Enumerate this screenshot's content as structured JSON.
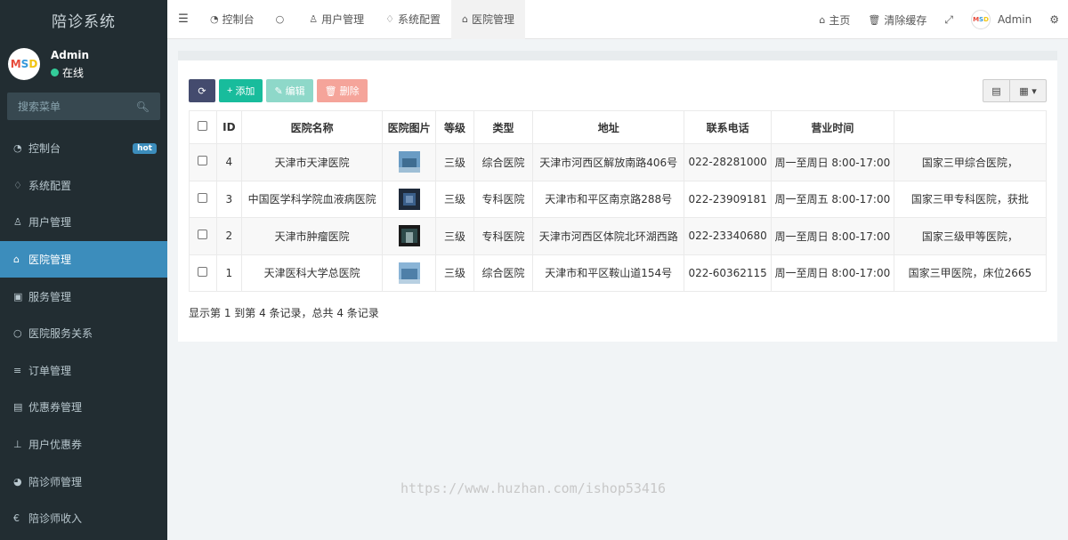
{
  "brand": "陪诊系统",
  "user": {
    "name": "Admin",
    "status": "在线",
    "avatar_text": "MSD"
  },
  "search": {
    "placeholder": "搜索菜单"
  },
  "menu": [
    {
      "label": "控制台",
      "icon": "dashboard-icon",
      "badge": "hot"
    },
    {
      "label": "系统配置",
      "icon": "bell-icon"
    },
    {
      "label": "用户管理",
      "icon": "user-icon"
    },
    {
      "label": "医院管理",
      "icon": "bank-icon",
      "active": true
    },
    {
      "label": "服务管理",
      "icon": "square-icon"
    },
    {
      "label": "医院服务关系",
      "icon": "circle-icon"
    },
    {
      "label": "订单管理",
      "icon": "list-icon"
    },
    {
      "label": "优惠券管理",
      "icon": "file-icon"
    },
    {
      "label": "用户优惠券",
      "icon": "sitemap-icon"
    },
    {
      "label": "陪诊师管理",
      "icon": "github-icon"
    },
    {
      "label": "陪诊师收入",
      "icon": "euro-icon"
    }
  ],
  "header": {
    "tabs": [
      {
        "label": "控制台",
        "icon": "dashboard-icon"
      },
      {
        "label": "",
        "icon": "circle-icon"
      },
      {
        "label": "用户管理",
        "icon": "user-icon"
      },
      {
        "label": "系统配置",
        "icon": "bell-icon"
      },
      {
        "label": "医院管理",
        "icon": "bank-icon",
        "active": true
      }
    ],
    "home": "主页",
    "clear_cache": "清除缓存",
    "admin": "Admin"
  },
  "toolbar": {
    "add": "添加",
    "edit": "编辑",
    "delete": "删除"
  },
  "table": {
    "columns": [
      "ID",
      "医院名称",
      "医院图片",
      "等级",
      "类型",
      "地址",
      "联系电话",
      "营业时间",
      ""
    ],
    "rows": [
      {
        "id": "4",
        "name": "天津市天津医院",
        "level": "三级",
        "type": "综合医院",
        "address": "天津市河西区解放南路406号",
        "phone": "022-28281000",
        "hours": "周一至周日 8:00-17:00",
        "desc": "国家三甲综合医院，"
      },
      {
        "id": "3",
        "name": "中国医学科学院血液病医院",
        "level": "三级",
        "type": "专科医院",
        "address": "天津市和平区南京路288号",
        "phone": "022-23909181",
        "hours": "周一至周五 8:00-17:00",
        "desc": "国家三甲专科医院，获批"
      },
      {
        "id": "2",
        "name": "天津市肿瘤医院",
        "level": "三级",
        "type": "专科医院",
        "address": "天津市河西区体院北环湖西路",
        "phone": "022-23340680",
        "hours": "周一至周日 8:00-17:00",
        "desc": "国家三级甲等医院，"
      },
      {
        "id": "1",
        "name": "天津医科大学总医院",
        "level": "三级",
        "type": "综合医院",
        "address": "天津市和平区鞍山道154号",
        "phone": "022-60362115",
        "hours": "周一至周日 8:00-17:00",
        "desc": "国家三甲医院，床位2665"
      }
    ]
  },
  "pagination": "显示第 1 到第 4 条记录，总共 4 条记录",
  "watermark": "https://www.huzhan.com/ishop53416"
}
